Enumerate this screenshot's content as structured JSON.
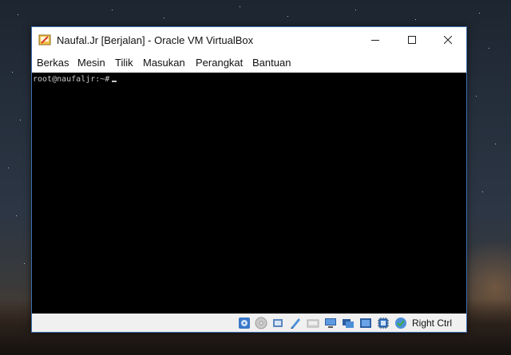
{
  "window": {
    "title": "Naufal.Jr [Berjalan] - Oracle VM VirtualBox",
    "app_icon": "virtualbox-vm-icon"
  },
  "menu": {
    "items": [
      "Berkas",
      "Mesin",
      "Tilik",
      "Masukan",
      "Perangkat",
      "Bantuan"
    ]
  },
  "console": {
    "prompt": "root@naufaljr:~#"
  },
  "statusbar": {
    "icons": [
      "hard-disk-icon",
      "optical-drive-icon",
      "audio-icon",
      "network-icon",
      "usb-icon",
      "shared-folders-icon",
      "display-icon",
      "video-capture-icon",
      "cpu-icon",
      "guest-additions-icon",
      "mouse-integration-icon"
    ],
    "host_key": "Right Ctrl"
  },
  "colors": {
    "console_bg": "#000000",
    "console_text": "#c8c8c8",
    "accent": "#2b7cd3"
  }
}
